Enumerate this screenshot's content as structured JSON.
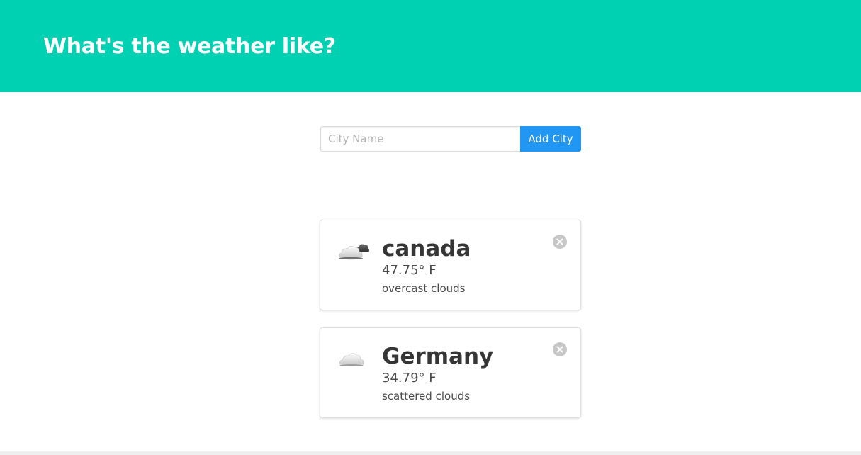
{
  "header": {
    "title": "What's the weather like?",
    "background_color": "#00d1b2"
  },
  "add_form": {
    "placeholder": "City Name",
    "value": "",
    "button_label": "Add City",
    "button_color": "#2196f3"
  },
  "cities": [
    {
      "name": "canada",
      "temperature": "47.75° F",
      "description": "overcast clouds",
      "icon": "overcast-clouds-icon"
    },
    {
      "name": "Germany",
      "temperature": "34.79° F",
      "description": "scattered clouds",
      "icon": "scattered-clouds-icon"
    }
  ]
}
